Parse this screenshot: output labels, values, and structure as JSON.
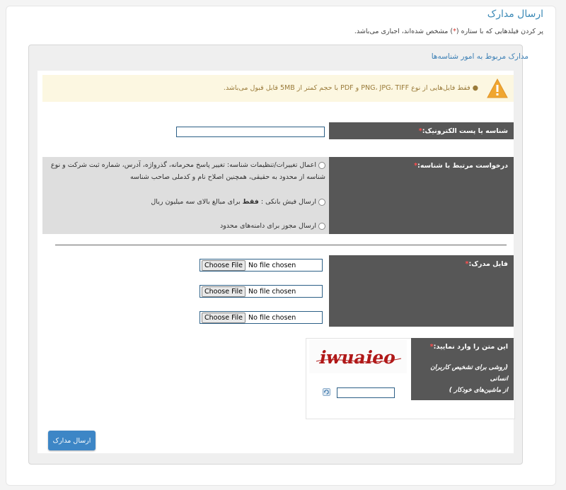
{
  "page": {
    "title": "ارسال مدارک",
    "required_note_before": "پر کردن فیلدهایی که با ستاره (",
    "required_star": "*",
    "required_note_after": ") مشخص شده‌اند، اجباری می‌باشد."
  },
  "section": {
    "title": "مدارک مربوط به امور شناسه‌ها"
  },
  "warning": {
    "text": "فقط فایل‌هایی از نوع PNG، JPG، TIFF و PDF با حجم کمتر از 5MB قابل قبول می‌باشد.",
    "icon": "warning-triangle-icon"
  },
  "form": {
    "star": "*",
    "email_label": "شناسه یا پست الکترونیک:",
    "email_value": "",
    "request_label": "درخواست مرتبط با شناسه:",
    "options": [
      {
        "line1": "اعمال تغییرات/تنظیمات شناسه: تغییر پاسخ محرمانه، گذرواژه، آدرس، شماره ثبت شرکت و نوع",
        "line2": "شناسه از محدود به حقیقی، همچنین اصلاح نام و کدملی صاحب شناسه"
      },
      {
        "before": "ارسال فیش بانکی : ",
        "bold": "فقط",
        "after": " برای مبالغ بالای سه میلیون ریال"
      },
      {
        "text": "ارسال مجوز برای دامنه‌های محدود"
      }
    ],
    "file_label": "فایل مدرک:",
    "file_button": "Choose File",
    "file_status": "No file chosen",
    "captcha_label": "این متن را وارد نمایید:",
    "captcha_hint_1": "(روشی برای تشخیص کاربران انسانی",
    "captcha_hint_2": "از ماشین‌های خودکار )",
    "captcha_text": "iwuaieo",
    "refresh_icon": "refresh-icon",
    "submit_label": "ارسال مدارک"
  },
  "colors": {
    "accent": "#3b89b6",
    "label_bg": "#575757",
    "button": "#3d86c6",
    "warning_bg": "#fcf7e1",
    "star": "#d9342b"
  }
}
